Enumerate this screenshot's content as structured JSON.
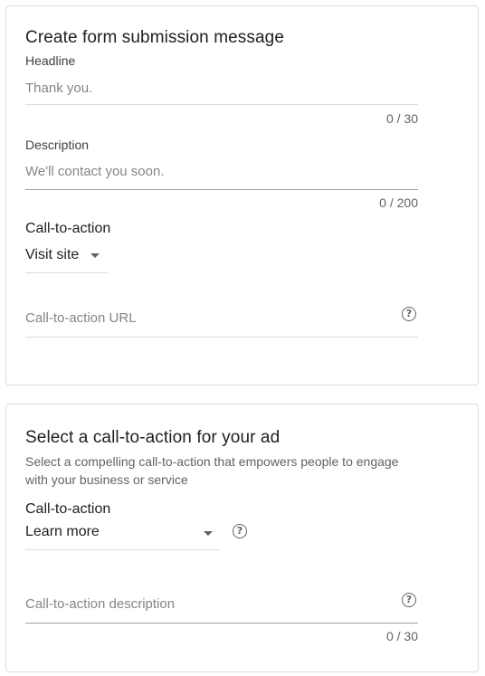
{
  "submission_card": {
    "title": "Create form submission message",
    "headline": {
      "label": "Headline",
      "placeholder": "Thank you.",
      "counter": "0 / 30"
    },
    "description": {
      "label": "Description",
      "placeholder": "We'll contact you soon.",
      "counter": "0 / 200"
    },
    "cta": {
      "label": "Call-to-action",
      "value": "Visit site"
    },
    "cta_url": {
      "placeholder": "Call-to-action URL",
      "help_icon": "?"
    }
  },
  "cta_card": {
    "title": "Select a call-to-action for your ad",
    "subtitle": "Select a compelling call-to-action that empowers people to engage with your business or service",
    "cta": {
      "label": "Call-to-action",
      "value": "Learn more",
      "help_icon": "?"
    },
    "cta_description": {
      "placeholder": "Call-to-action description",
      "counter": "0 / 30",
      "help_icon": "?"
    }
  },
  "icons": {
    "dropdown": "caret-down",
    "help": "help-circle"
  },
  "colors": {
    "border": "#dadce0",
    "text": "#202124",
    "muted": "#5f6368",
    "placeholder": "#80868b"
  }
}
